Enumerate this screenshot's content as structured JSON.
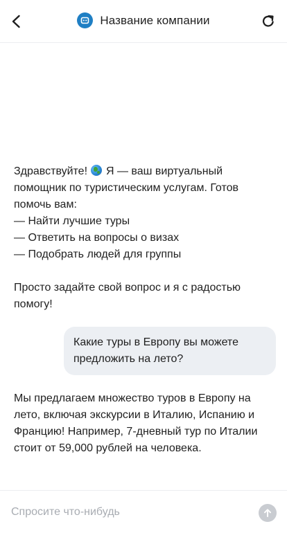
{
  "header": {
    "back_icon": "chevron-left-icon",
    "company_name": "Название компании",
    "avatar_icon": "bot-icon",
    "refresh_icon": "refresh-icon",
    "accent_color": "#1f7fc4"
  },
  "messages": {
    "bot_greeting": {
      "line1_before_emoji": "Здравствуйте!",
      "emoji_icon": "globe-icon",
      "line1_after_emoji": "Я — ваш виртуальный помощник по туристическим услугам. Готов помочь вам:",
      "items": [
        "— Найти лучшие туры",
        "— Ответить на вопросы о визах",
        "— Подобрать людей для группы"
      ],
      "closing": "Просто задайте свой вопрос и я с радостью помогу!"
    },
    "user_question": "Какие туры в Европу вы можете предложить на лето?",
    "bot_answer": "Мы предлагаем множество туров в Европу на лето, включая экскурсии в Италию, Испанию и Францию! Например, 7-дневный тур по Италии стоит от 59,000 рублей на человека."
  },
  "composer": {
    "placeholder": "Спросите что-нибудь",
    "value": "",
    "send_icon": "arrow-up-icon"
  }
}
